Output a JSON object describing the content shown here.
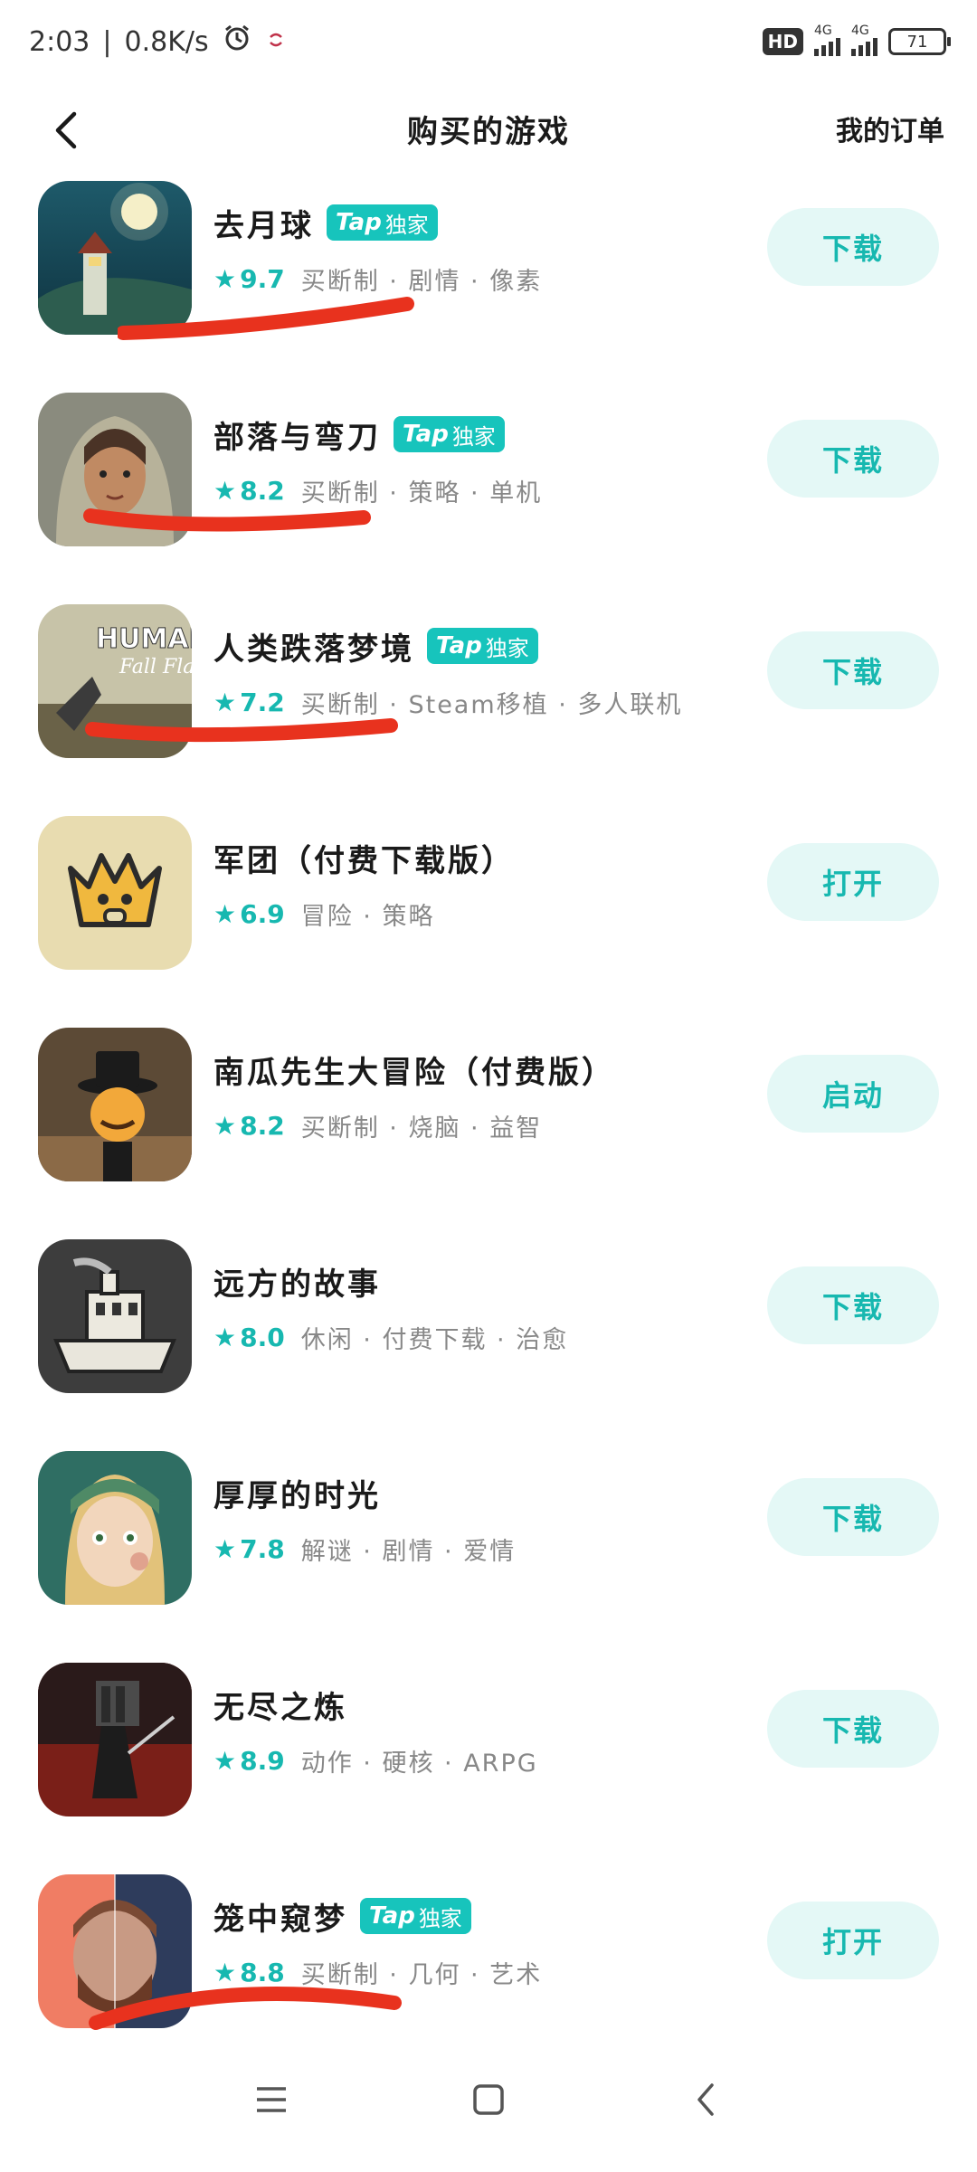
{
  "status_bar": {
    "time": "2:03",
    "separator": "|",
    "speed": "0.8K/s",
    "hd_badge": "HD",
    "net1": "4G",
    "net2": "4G",
    "battery": "71"
  },
  "header": {
    "title": "购买的游戏",
    "orders_link": "我的订单",
    "back_icon": "chevron-left-icon"
  },
  "badge": {
    "tap": "Tap",
    "exclusive": "独家"
  },
  "colors": {
    "accent": "#17b8b0",
    "button_bg": "#e4f8f6",
    "scribble": "#e8321e"
  },
  "games": [
    {
      "name": "去月球",
      "exclusive": true,
      "rating": "9.7",
      "tags": "买断制 · 剧情 · 像素",
      "action": "下载"
    },
    {
      "name": "部落与弯刀",
      "exclusive": true,
      "rating": "8.2",
      "tags": "买断制 · 策略 · 单机",
      "action": "下载"
    },
    {
      "name": "人类跌落梦境",
      "exclusive": true,
      "rating": "7.2",
      "tags": "买断制 · Steam移植 · 多人联机",
      "action": "下载",
      "icon_text1": "HUMAN",
      "icon_text2": "Fall Flat"
    },
    {
      "name": "军团（付费下载版）",
      "exclusive": false,
      "rating": "6.9",
      "tags": "冒险 · 策略",
      "action": "打开"
    },
    {
      "name": "南瓜先生大冒险（付费版）",
      "exclusive": false,
      "rating": "8.2",
      "tags": "买断制 · 烧脑 · 益智",
      "action": "启动"
    },
    {
      "name": "远方的故事",
      "exclusive": false,
      "rating": "8.0",
      "tags": "休闲 · 付费下载 · 治愈",
      "action": "下载"
    },
    {
      "name": "厚厚的时光",
      "exclusive": false,
      "rating": "7.8",
      "tags": "解谜 · 剧情 · 爱情",
      "action": "下载"
    },
    {
      "name": "无尽之炼",
      "exclusive": false,
      "rating": "8.9",
      "tags": "动作 · 硬核 · ARPG",
      "action": "下载"
    },
    {
      "name": "笼中窥梦",
      "exclusive": true,
      "rating": "8.8",
      "tags": "买断制 · 几何 · 艺术",
      "action": "打开"
    }
  ]
}
